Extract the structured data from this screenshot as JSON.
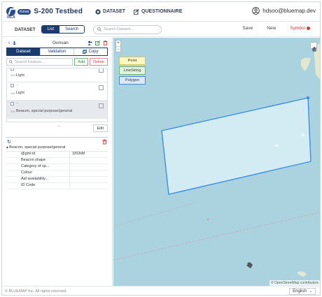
{
  "header": {
    "org": "IALA",
    "badge": "Korea",
    "title": "S-200 Testbed",
    "nav": [
      {
        "label": "DATASET",
        "icon": "dataset-icon"
      },
      {
        "label": "QUESTIONNAIRE",
        "icon": "questionnaire-icon"
      }
    ],
    "user_email": "hdsoo@bluemap.dev"
  },
  "toolbar": {
    "dataset_label": "DATASET",
    "view_toggle": [
      "List",
      "Search"
    ],
    "active_view": "List",
    "search_placeholder": "Search Dataset...",
    "save": "Save",
    "new": "New",
    "symbol": "Symbol"
  },
  "panel": {
    "dataset_name": "Gunsan",
    "copy_label": "Copy",
    "tabs": [
      "Dataset",
      "Validation"
    ],
    "active_tab": "Dataset",
    "feature_search_placeholder": "Search Feature...",
    "add_label": "Add",
    "delete_label": "Delete",
    "features": [
      {
        "code": "-",
        "num": "349",
        "type": "Light"
      },
      {
        "code": "-",
        "num": "349",
        "type": "Light"
      },
      {
        "code": "-",
        "num": "350",
        "type": "Beacon, special purpose/general"
      }
    ],
    "edit_label": "Edit",
    "attributes": {
      "title": "Beacon, special purpose/general",
      "rows": [
        {
          "key": "@gml:id",
          "value": "18SNM"
        },
        {
          "key": "Beacon shape",
          "value": ""
        },
        {
          "key": "Category of sp...",
          "value": ""
        },
        {
          "key": "Colour",
          "value": ""
        },
        {
          "key": "Aid availability...",
          "value": ""
        },
        {
          "key": "ID Code",
          "value": ""
        }
      ]
    }
  },
  "map": {
    "draw_tools": [
      "Point",
      "LineString",
      "Polygon"
    ],
    "attribution": "© OpenStreetMap contributors",
    "zoom_in": "+",
    "zoom_out": "−"
  },
  "footer": {
    "copyright": "© BLUEMAP Inc. All rights reserved.",
    "language": "English"
  },
  "colors": {
    "primary": "#1b3a6e",
    "sea": "#aad3df",
    "polygon_stroke": "#3d8ee6",
    "polygon_fill": "#dbeef6",
    "symbol_red": "#d23a3a"
  }
}
